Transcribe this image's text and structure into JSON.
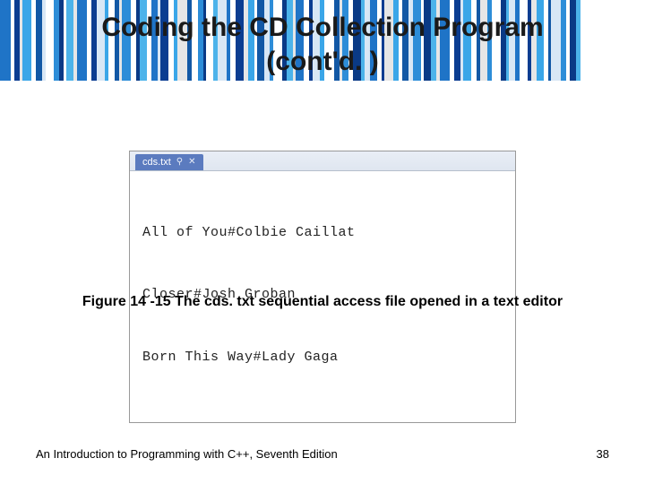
{
  "title_line1": "Coding the CD Collection Program",
  "title_line2": "(cont'd. )",
  "editor": {
    "tab_label": "cds.txt",
    "lines": [
      "All of You#Colbie Caillat",
      "Closer#Josh Groban",
      "Born This Way#Lady Gaga"
    ]
  },
  "caption": "Figure 14 -15 The cds. txt sequential access file opened in a text editor",
  "footer_text": "An Introduction to Programming with C++, Seventh Edition",
  "page_number": "38",
  "bars": [
    {
      "w": 12,
      "c": "#1f74c7"
    },
    {
      "w": 4,
      "c": "#ffffff"
    },
    {
      "w": 6,
      "c": "#0b3d91"
    },
    {
      "w": 3,
      "c": "#e6e6e6"
    },
    {
      "w": 10,
      "c": "#3aa6e8"
    },
    {
      "w": 5,
      "c": "#ffffff"
    },
    {
      "w": 7,
      "c": "#1258a5"
    },
    {
      "w": 4,
      "c": "#d8e7f5"
    },
    {
      "w": 9,
      "c": "#ffffff"
    },
    {
      "w": 6,
      "c": "#2d8dd8"
    },
    {
      "w": 5,
      "c": "#0a3a86"
    },
    {
      "w": 3,
      "c": "#ffffff"
    },
    {
      "w": 8,
      "c": "#4cb3ea"
    },
    {
      "w": 4,
      "c": "#e6e6e6"
    },
    {
      "w": 11,
      "c": "#1f74c7"
    },
    {
      "w": 5,
      "c": "#ffffff"
    },
    {
      "w": 6,
      "c": "#0b3d91"
    },
    {
      "w": 9,
      "c": "#d8e7f5"
    },
    {
      "w": 4,
      "c": "#3aa6e8"
    },
    {
      "w": 7,
      "c": "#ffffff"
    },
    {
      "w": 5,
      "c": "#1258a5"
    },
    {
      "w": 3,
      "c": "#e6e6e6"
    },
    {
      "w": 10,
      "c": "#2d8dd8"
    },
    {
      "w": 6,
      "c": "#ffffff"
    },
    {
      "w": 4,
      "c": "#0a3a86"
    },
    {
      "w": 8,
      "c": "#4cb3ea"
    },
    {
      "w": 5,
      "c": "#ffffff"
    },
    {
      "w": 7,
      "c": "#1f74c7"
    },
    {
      "w": 3,
      "c": "#d8e7f5"
    },
    {
      "w": 9,
      "c": "#0b3d91"
    },
    {
      "w": 6,
      "c": "#ffffff"
    },
    {
      "w": 4,
      "c": "#3aa6e8"
    },
    {
      "w": 11,
      "c": "#e6e6e6"
    },
    {
      "w": 5,
      "c": "#1258a5"
    },
    {
      "w": 7,
      "c": "#ffffff"
    },
    {
      "w": 6,
      "c": "#2d8dd8"
    },
    {
      "w": 3,
      "c": "#0a3a86"
    },
    {
      "w": 8,
      "c": "#ffffff"
    },
    {
      "w": 5,
      "c": "#4cb3ea"
    },
    {
      "w": 10,
      "c": "#d8e7f5"
    },
    {
      "w": 4,
      "c": "#1f74c7"
    },
    {
      "w": 6,
      "c": "#ffffff"
    },
    {
      "w": 9,
      "c": "#0b3d91"
    },
    {
      "w": 5,
      "c": "#e6e6e6"
    },
    {
      "w": 7,
      "c": "#3aa6e8"
    },
    {
      "w": 3,
      "c": "#ffffff"
    },
    {
      "w": 8,
      "c": "#1258a5"
    },
    {
      "w": 6,
      "c": "#d8e7f5"
    },
    {
      "w": 4,
      "c": "#2d8dd8"
    },
    {
      "w": 10,
      "c": "#ffffff"
    },
    {
      "w": 5,
      "c": "#0a3a86"
    },
    {
      "w": 7,
      "c": "#4cb3ea"
    },
    {
      "w": 3,
      "c": "#e6e6e6"
    },
    {
      "w": 9,
      "c": "#1f74c7"
    },
    {
      "w": 6,
      "c": "#ffffff"
    },
    {
      "w": 4,
      "c": "#0b3d91"
    },
    {
      "w": 8,
      "c": "#d8e7f5"
    },
    {
      "w": 5,
      "c": "#3aa6e8"
    },
    {
      "w": 11,
      "c": "#ffffff"
    },
    {
      "w": 6,
      "c": "#1258a5"
    },
    {
      "w": 3,
      "c": "#e6e6e6"
    },
    {
      "w": 7,
      "c": "#2d8dd8"
    },
    {
      "w": 5,
      "c": "#ffffff"
    },
    {
      "w": 9,
      "c": "#0a3a86"
    },
    {
      "w": 4,
      "c": "#4cb3ea"
    },
    {
      "w": 6,
      "c": "#d8e7f5"
    },
    {
      "w": 8,
      "c": "#1f74c7"
    },
    {
      "w": 5,
      "c": "#ffffff"
    },
    {
      "w": 3,
      "c": "#0b3d91"
    },
    {
      "w": 10,
      "c": "#e6e6e6"
    },
    {
      "w": 6,
      "c": "#3aa6e8"
    },
    {
      "w": 4,
      "c": "#ffffff"
    },
    {
      "w": 7,
      "c": "#1258a5"
    },
    {
      "w": 5,
      "c": "#d8e7f5"
    },
    {
      "w": 9,
      "c": "#2d8dd8"
    },
    {
      "w": 3,
      "c": "#ffffff"
    },
    {
      "w": 8,
      "c": "#0a3a86"
    },
    {
      "w": 6,
      "c": "#4cb3ea"
    },
    {
      "w": 4,
      "c": "#e6e6e6"
    },
    {
      "w": 11,
      "c": "#1f74c7"
    },
    {
      "w": 5,
      "c": "#ffffff"
    },
    {
      "w": 7,
      "c": "#0b3d91"
    },
    {
      "w": 3,
      "c": "#d8e7f5"
    },
    {
      "w": 9,
      "c": "#3aa6e8"
    },
    {
      "w": 6,
      "c": "#ffffff"
    },
    {
      "w": 4,
      "c": "#1258a5"
    },
    {
      "w": 8,
      "c": "#e6e6e6"
    },
    {
      "w": 5,
      "c": "#2d8dd8"
    },
    {
      "w": 10,
      "c": "#ffffff"
    },
    {
      "w": 6,
      "c": "#0a3a86"
    },
    {
      "w": 3,
      "c": "#4cb3ea"
    },
    {
      "w": 7,
      "c": "#d8e7f5"
    },
    {
      "w": 5,
      "c": "#1f74c7"
    },
    {
      "w": 9,
      "c": "#ffffff"
    },
    {
      "w": 4,
      "c": "#0b3d91"
    },
    {
      "w": 6,
      "c": "#e6e6e6"
    },
    {
      "w": 8,
      "c": "#3aa6e8"
    },
    {
      "w": 5,
      "c": "#ffffff"
    },
    {
      "w": 3,
      "c": "#1258a5"
    },
    {
      "w": 11,
      "c": "#d8e7f5"
    },
    {
      "w": 6,
      "c": "#2d8dd8"
    },
    {
      "w": 4,
      "c": "#ffffff"
    },
    {
      "w": 7,
      "c": "#0a3a86"
    },
    {
      "w": 5,
      "c": "#4cb3ea"
    }
  ]
}
